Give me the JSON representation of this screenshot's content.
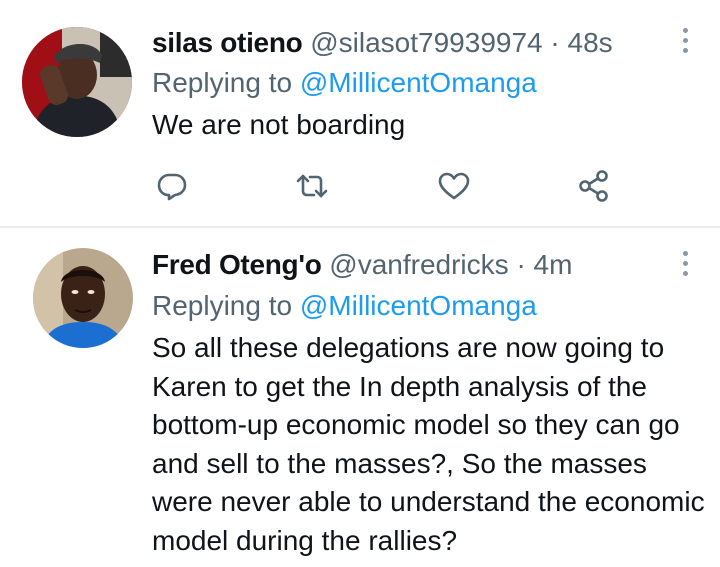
{
  "tweets": [
    {
      "name": "silas otieno",
      "handle": "@silasot79939974",
      "separator": "·",
      "time": "48s",
      "replying_prefix": "Replying to",
      "replying_to": "@MillicentOmanga",
      "text": "We are not boarding",
      "actions": [
        "reply-icon",
        "retweet-icon",
        "like-icon",
        "share-icon"
      ]
    },
    {
      "name": "Fred Oteng'o",
      "handle": "@vanfredricks",
      "separator": "·",
      "time": "4m",
      "replying_prefix": "Replying to",
      "replying_to": "@MillicentOmanga",
      "text": "So all these delegations are now going to Karen to get the In depth analysis of the bottom-up economic model so they can go and sell to the masses?, So the masses were never able to understand the economic model during the rallies?"
    }
  ],
  "colors": {
    "text": "#0f1419",
    "secondary": "#536471",
    "link": "#1d9bf0",
    "icon": "#536471",
    "divider": "#e6ecf0"
  }
}
